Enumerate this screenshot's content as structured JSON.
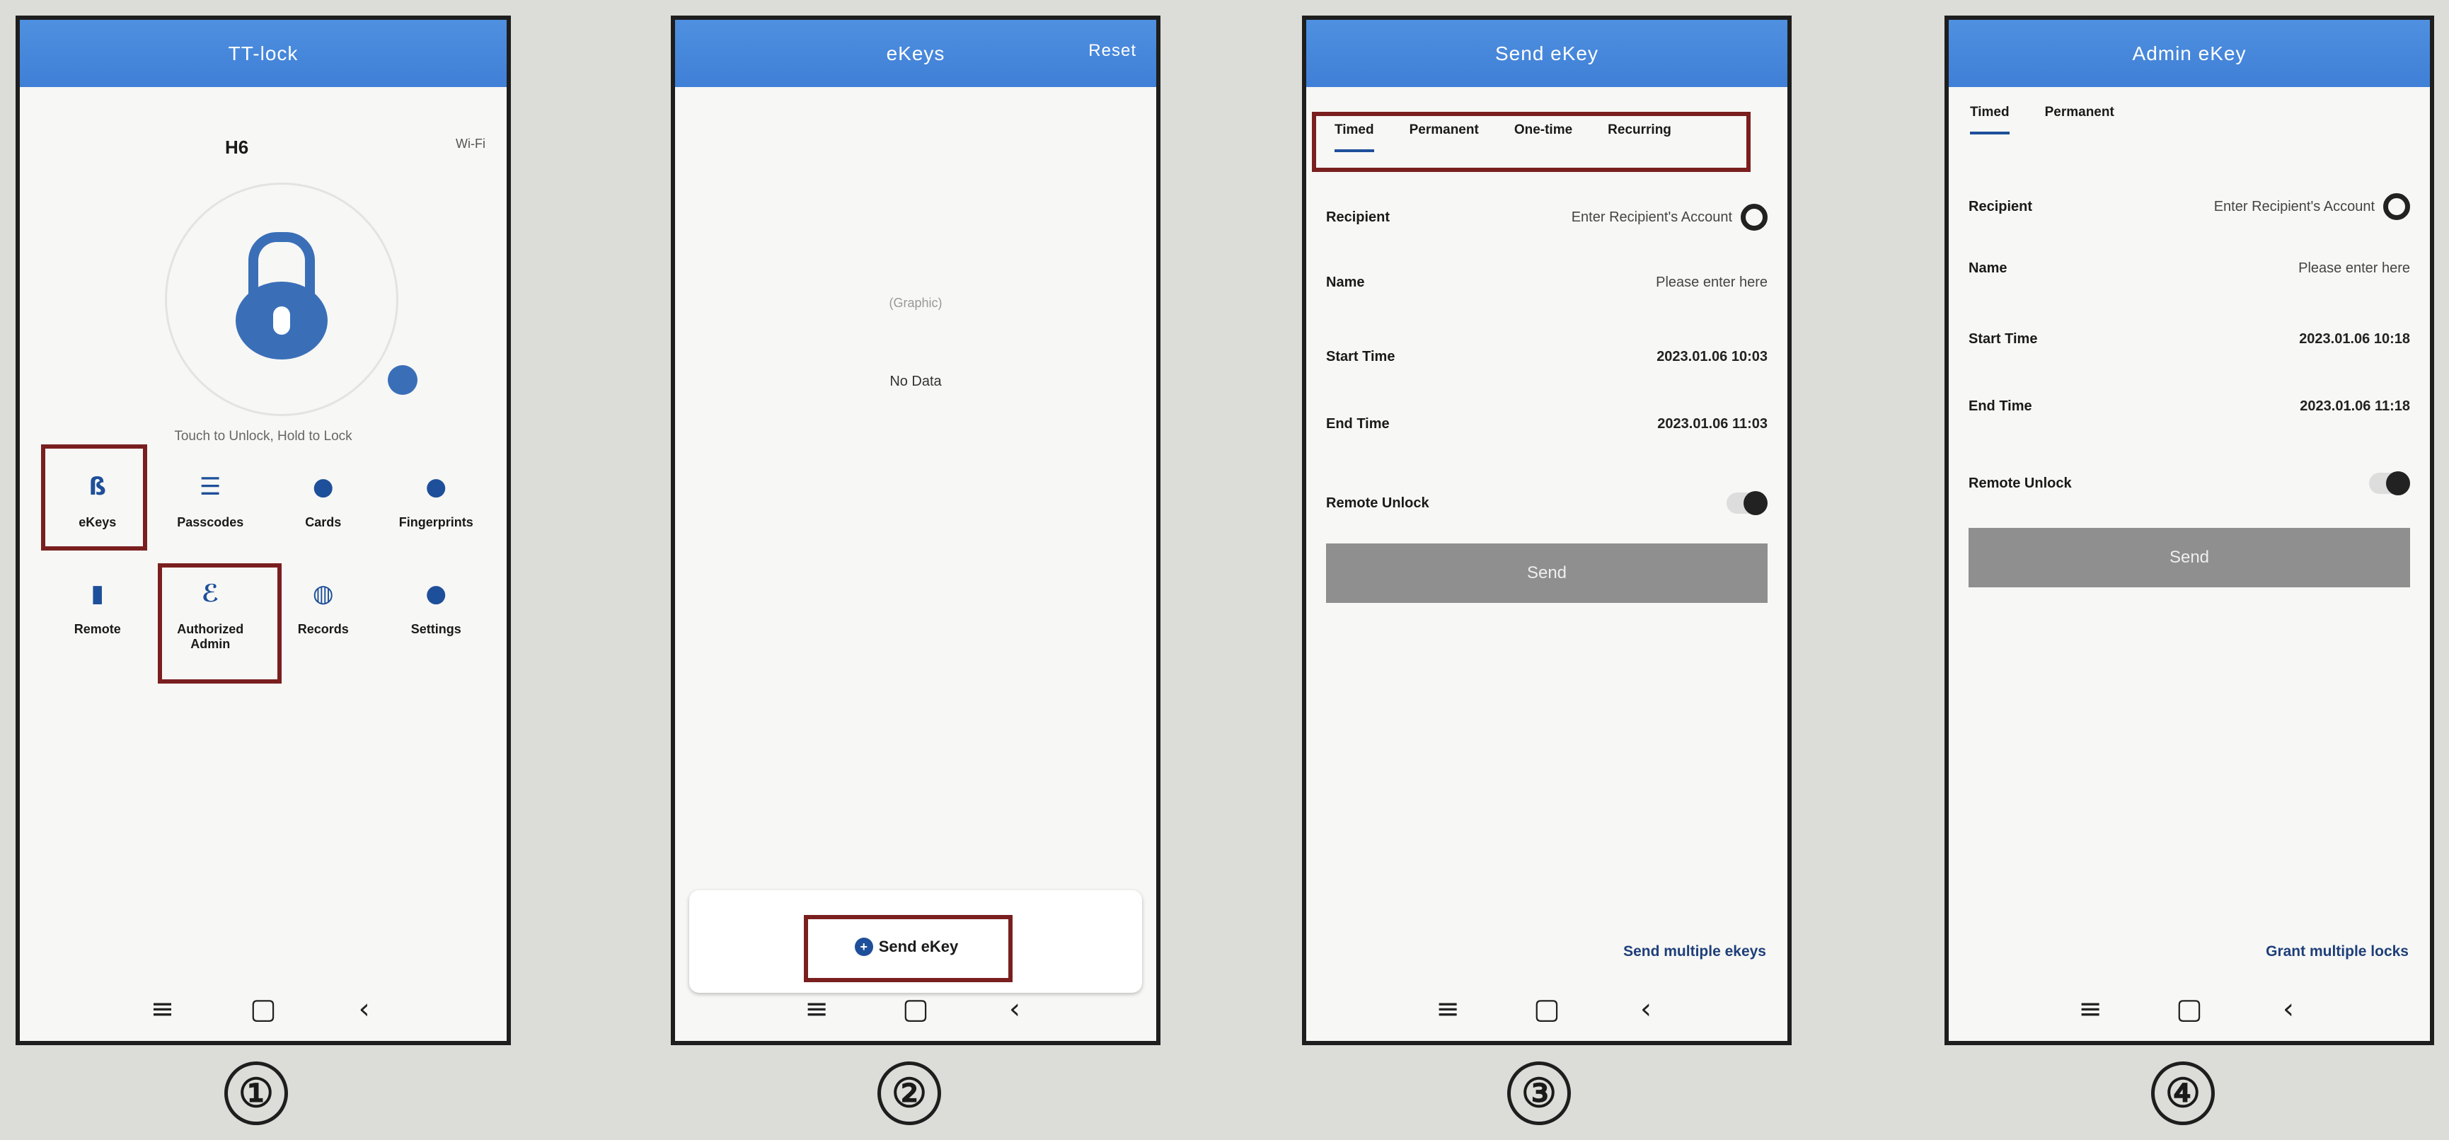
{
  "screen1": {
    "topbar_title": "TT-lock",
    "lock_name": "H6",
    "status": "Wi-Fi",
    "hint": "Touch to Unlock, Hold to Lock",
    "grid": [
      {
        "icon": "key-icon",
        "glyph": "ß",
        "label": "eKeys"
      },
      {
        "icon": "passcode-icon",
        "glyph": "☰",
        "label": "Passcodes"
      },
      {
        "icon": "card-icon",
        "glyph": "●",
        "label": "Cards"
      },
      {
        "icon": "fingerprint-icon",
        "glyph": "●",
        "label": "Fingerprints"
      },
      {
        "icon": "remote-icon",
        "glyph": "▮",
        "label": "Remote"
      },
      {
        "icon": "admin-icon",
        "glyph": "ℰ",
        "label": "Authorized Admin"
      },
      {
        "icon": "records-icon",
        "glyph": "◍",
        "label": "Records"
      },
      {
        "icon": "settings-icon",
        "glyph": "●",
        "label": "Settings"
      }
    ],
    "caption": "①"
  },
  "screen2": {
    "topbar_title": "eKeys",
    "topbar_right": "Reset",
    "empty_label": "(Graphic)",
    "nodata": "No Data",
    "send_label": "Send eKey",
    "caption": "②"
  },
  "screen3": {
    "topbar_title": "Send eKey",
    "tabs": [
      "Timed",
      "Permanent",
      "One-time",
      "Recurring"
    ],
    "recipient_label": "Recipient",
    "recipient_value": "Enter Recipient's Account",
    "name_label": "Name",
    "name_value": "Please enter here",
    "start_label": "Start Time",
    "start_value": "2023.01.06 10:03",
    "end_label": "End Time",
    "end_value": "2023.01.06 11:03",
    "remote_label": "Remote Unlock",
    "send_label": "Send",
    "footer_link": "Send multiple ekeys",
    "caption": "③"
  },
  "screen4": {
    "topbar_title": "Admin eKey",
    "tabs": [
      "Timed",
      "Permanent"
    ],
    "recipient_label": "Recipient",
    "recipient_value": "Enter Recipient's Account",
    "name_label": "Name",
    "name_value": "Please enter here",
    "start_label": "Start Time",
    "start_value": "2023.01.06 10:18",
    "end_label": "End Time",
    "end_value": "2023.01.06 11:18",
    "remote_label": "Remote Unlock",
    "send_label": "Send",
    "footer_link": "Grant multiple locks",
    "caption": "④"
  },
  "navbar": {
    "menu": "≡",
    "home": "▢",
    "back": "‹"
  }
}
